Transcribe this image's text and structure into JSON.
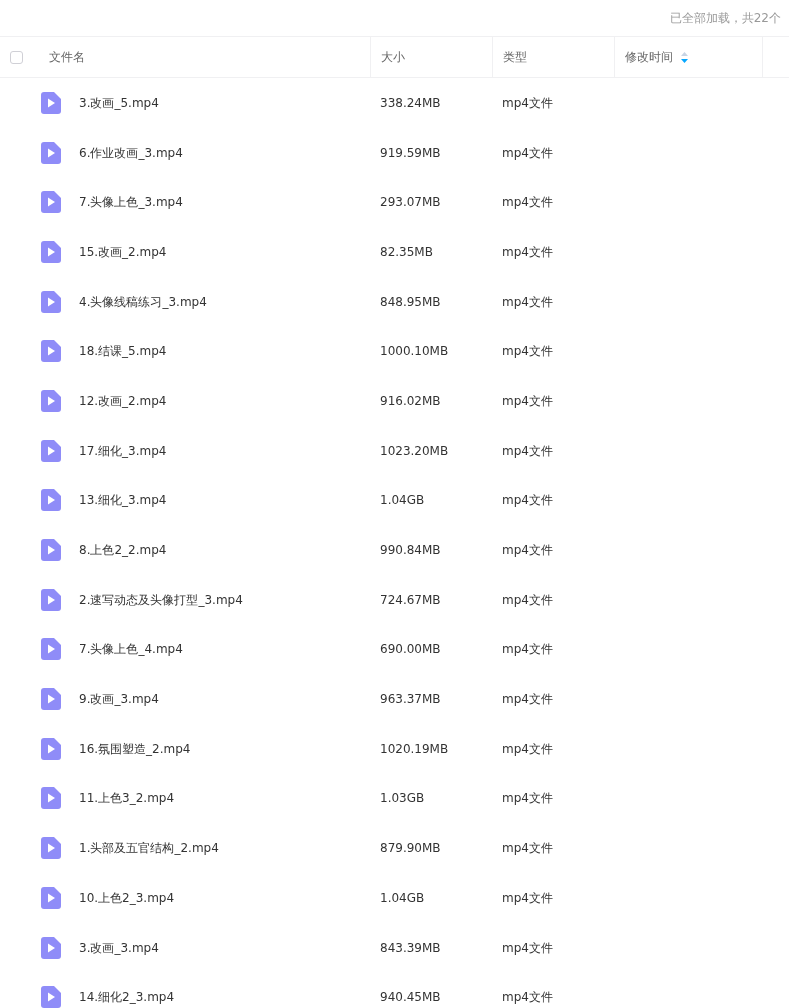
{
  "summary": "已全部加载，共22个",
  "table": {
    "select_all": {
      "checked": false
    },
    "columns": [
      {
        "label": "文件名",
        "sortable": false
      },
      {
        "label": "大小",
        "sortable": false
      },
      {
        "label": "类型",
        "sortable": false
      },
      {
        "label": "修改时间",
        "sortable": true
      }
    ],
    "rows": [
      {
        "name": "3.改画_5.mp4",
        "size": "338.24MB",
        "type": "mp4文件"
      },
      {
        "name": "6.作业改画_3.mp4",
        "size": "919.59MB",
        "type": "mp4文件"
      },
      {
        "name": "7.头像上色_3.mp4",
        "size": "293.07MB",
        "type": "mp4文件"
      },
      {
        "name": "15.改画_2.mp4",
        "size": "82.35MB",
        "type": "mp4文件"
      },
      {
        "name": "4.头像线稿练习_3.mp4",
        "size": "848.95MB",
        "type": "mp4文件"
      },
      {
        "name": "18.结课_5.mp4",
        "size": "1000.10MB",
        "type": "mp4文件"
      },
      {
        "name": "12.改画_2.mp4",
        "size": "916.02MB",
        "type": "mp4文件"
      },
      {
        "name": "17.细化_3.mp4",
        "size": "1023.20MB",
        "type": "mp4文件"
      },
      {
        "name": "13.细化_3.mp4",
        "size": "1.04GB",
        "type": "mp4文件"
      },
      {
        "name": "8.上色2_2.mp4",
        "size": "990.84MB",
        "type": "mp4文件"
      },
      {
        "name": "2.速写动态及头像打型_3.mp4",
        "size": "724.67MB",
        "type": "mp4文件"
      },
      {
        "name": "7.头像上色_4.mp4",
        "size": "690.00MB",
        "type": "mp4文件"
      },
      {
        "name": "9.改画_3.mp4",
        "size": "963.37MB",
        "type": "mp4文件"
      },
      {
        "name": "16.氛围塑造_2.mp4",
        "size": "1020.19MB",
        "type": "mp4文件"
      },
      {
        "name": "11.上色3_2.mp4",
        "size": "1.03GB",
        "type": "mp4文件"
      },
      {
        "name": "1.头部及五官结构_2.mp4",
        "size": "879.90MB",
        "type": "mp4文件"
      },
      {
        "name": "10.上色2_3.mp4",
        "size": "1.04GB",
        "type": "mp4文件"
      },
      {
        "name": "3.改画_3.mp4",
        "size": "843.39MB",
        "type": "mp4文件"
      },
      {
        "name": "14.细化2_3.mp4",
        "size": "940.45MB",
        "type": "mp4文件"
      }
    ]
  }
}
